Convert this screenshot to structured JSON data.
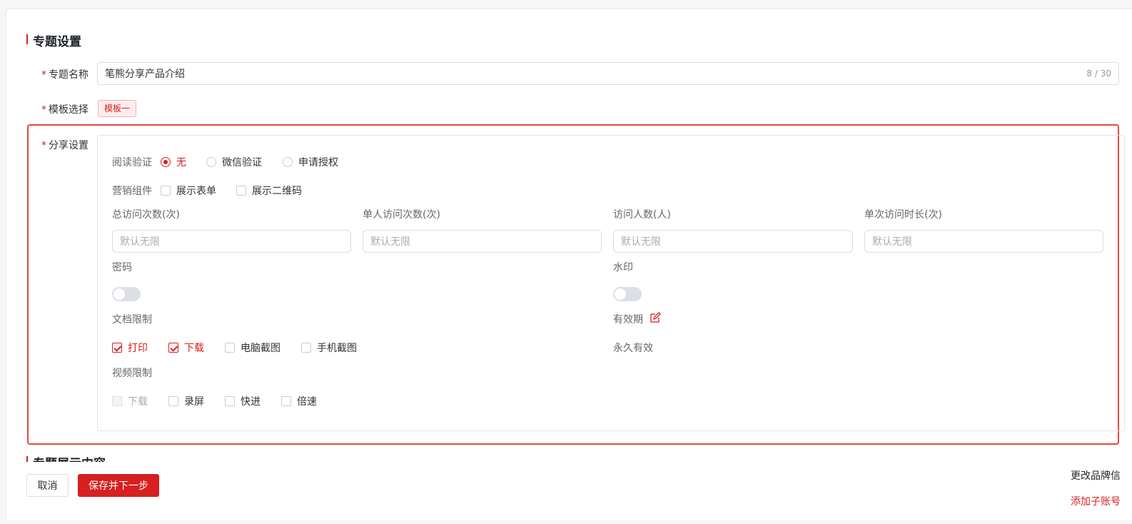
{
  "sections": {
    "topic_settings": "专题设置",
    "topic_display": "专题展示内容"
  },
  "form": {
    "topic_name": {
      "label": "专题名称",
      "value": "笔熊分享产品介绍",
      "counter": "8 / 30"
    },
    "template": {
      "label": "模板选择",
      "tag": "模板一"
    },
    "share": {
      "label": "分享设置"
    },
    "required_mark": "*"
  },
  "share": {
    "read_verify": {
      "label": "阅读验证",
      "options": [
        "无",
        "微信验证",
        "申请授权"
      ],
      "selected": "无"
    },
    "marketing": {
      "label": "营销组件",
      "options": [
        "展示表单",
        "展示二维码"
      ]
    },
    "limits": [
      {
        "label": "总访问次数(次)",
        "placeholder": "默认无限"
      },
      {
        "label": "单人访问次数(次)",
        "placeholder": "默认无限"
      },
      {
        "label": "访问人数(人)",
        "placeholder": "默认无限"
      },
      {
        "label": "单次访问时长(次)",
        "placeholder": "默认无限"
      }
    ],
    "password": {
      "label": "密码",
      "enabled": false
    },
    "watermark": {
      "label": "水印",
      "enabled": false
    },
    "doc_limit": {
      "label": "文档限制",
      "options": [
        {
          "label": "打印",
          "checked": true
        },
        {
          "label": "下载",
          "checked": true
        },
        {
          "label": "电脑截图",
          "checked": false
        },
        {
          "label": "手机截图",
          "checked": false
        }
      ]
    },
    "validity": {
      "label": "有效期",
      "value": "永久有效"
    },
    "video_limit": {
      "label": "视频限制",
      "options": [
        {
          "label": "下载",
          "checked": false,
          "disabled": true
        },
        {
          "label": "录屏",
          "checked": false
        },
        {
          "label": "快进",
          "checked": false
        },
        {
          "label": "倍速",
          "checked": false
        }
      ]
    }
  },
  "footer": {
    "cancel": "取消",
    "save_next": "保存并下一步"
  },
  "floating": {
    "rebrand": "更改品牌信",
    "add_sub": "添加子账号"
  },
  "colors": {
    "accent": "#d71f1f",
    "highlight_border": "#e2483f"
  }
}
